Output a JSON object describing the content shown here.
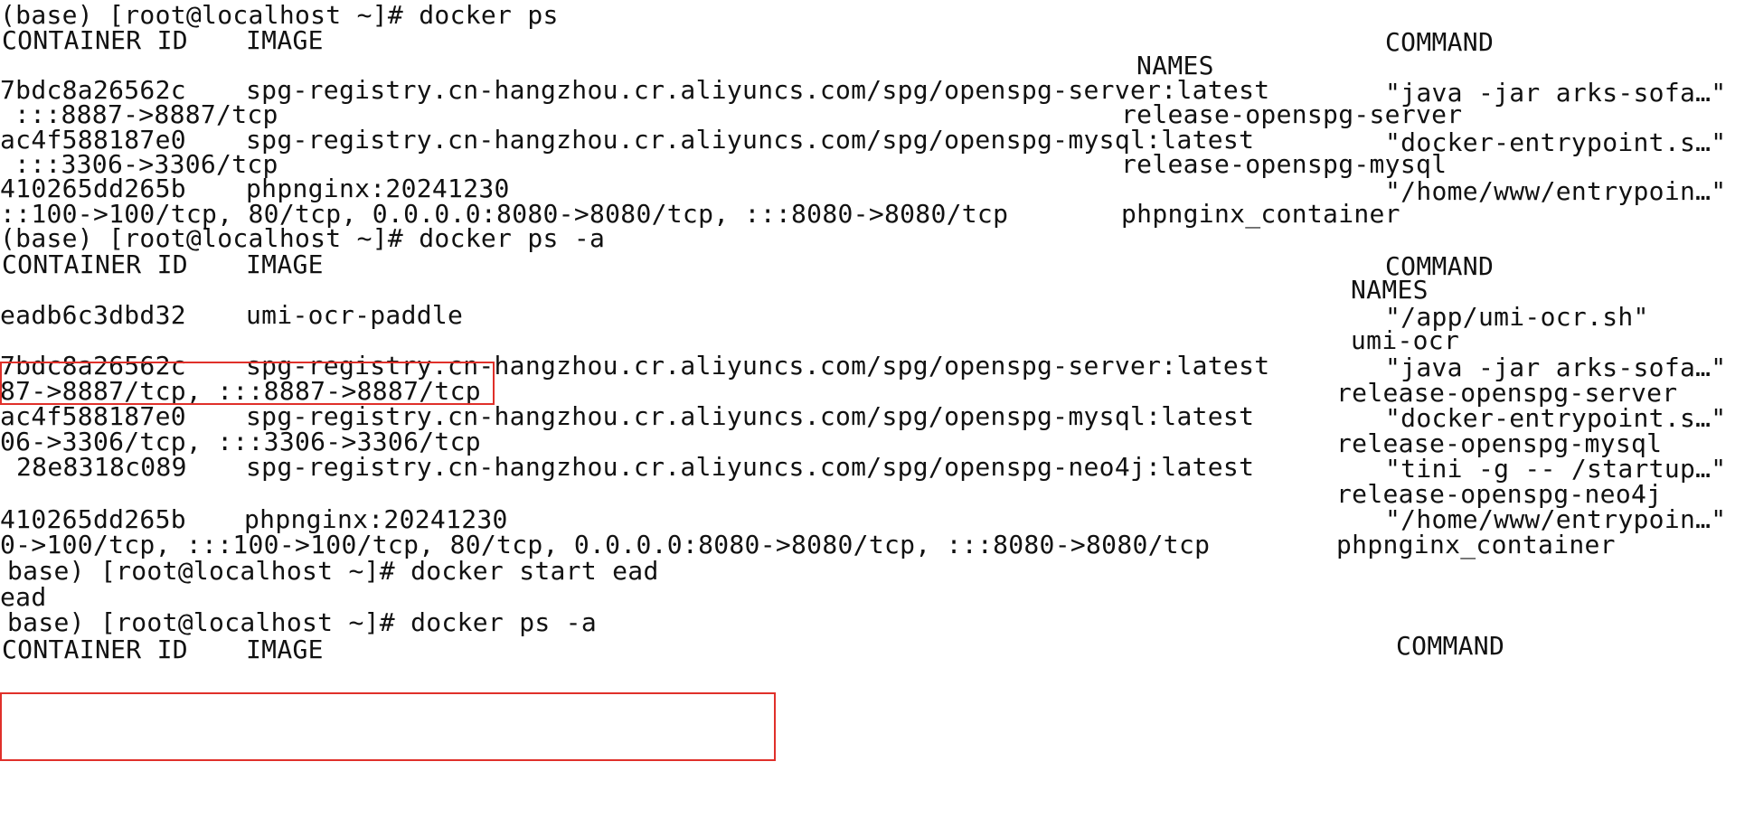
{
  "colors": {
    "background": "#ffffff",
    "text": "#111111",
    "highlight_box": "#e0302a"
  },
  "terminal": {
    "lines": [
      "(base) [root@localhost ~]# docker ps",
      "CONTAINER ID",
      "IMAGE",
      "COMMAND",
      "NAMES",
      "7bdc8a26562c",
      "spg-registry.cn-hangzhou.cr.aliyuncs.com/spg/openspg-server:latest",
      "\"java -jar arks-sofa…\"",
      ":::8887->8887/tcp",
      "release-openspg-server",
      "ac4f588187e0",
      "spg-registry.cn-hangzhou.cr.aliyuncs.com/spg/openspg-mysql:latest",
      "\"docker-entrypoint.s…\"",
      ":::3306->3306/tcp",
      "release-openspg-mysql",
      "410265dd265b",
      "phpnginx:20241230",
      "\"/home/www/entrypoin…\"",
      "::100->100/tcp, 80/tcp, 0.0.0.0:8080->8080/tcp, :::8080->8080/tcp",
      "phpnginx_container",
      "(base) [root@localhost ~]# docker ps -a",
      "CONTAINER ID",
      "IMAGE",
      "COMMAND",
      "NAMES",
      "eadb6c3dbd32",
      "umi-ocr-paddle",
      "\"/app/umi-ocr.sh\"",
      "umi-ocr",
      "7bdc8a26562c",
      "spg-registry.cn-hangzhou.cr.aliyuncs.com/spg/openspg-server:latest",
      "\"java -jar arks-sofa…\"",
      "87->8887/tcp, :::8887->8887/tcp",
      "release-openspg-server",
      "ac4f588187e0",
      "spg-registry.cn-hangzhou.cr.aliyuncs.com/spg/openspg-mysql:latest",
      "\"docker-entrypoint.s…\"",
      "06->3306/tcp, :::3306->3306/tcp",
      "release-openspg-mysql",
      "28e8318c089",
      "spg-registry.cn-hangzhou.cr.aliyuncs.com/spg/openspg-neo4j:latest",
      "\"tini -g -- /startup…\"",
      "release-openspg-neo4j",
      "410265dd265b",
      "phpnginx:20241230",
      "\"/home/www/entrypoin…\"",
      "0->100/tcp, :::100->100/tcp, 80/tcp, 0.0.0.0:8080->8080/tcp, :::8080->8080/tcp",
      "phpnginx_container",
      "base) [root@localhost ~]# docker start ead",
      "ead",
      "base) [root@localhost ~]# docker ps -a",
      "CONTAINER ID",
      "IMAGE",
      "COMMAND"
    ]
  }
}
